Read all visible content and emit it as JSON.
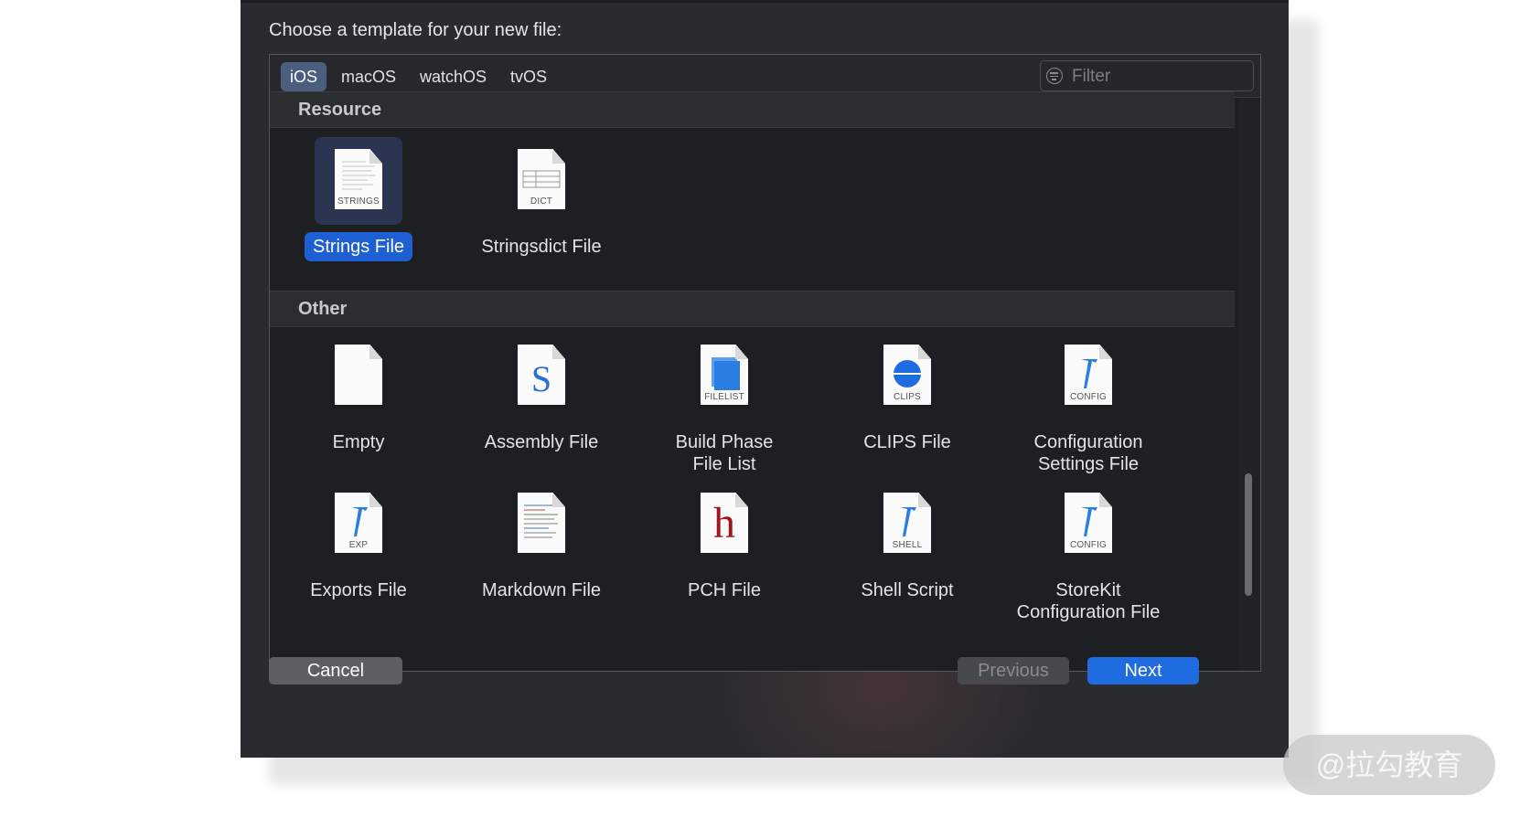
{
  "dialog": {
    "title": "Choose a template for your new file:"
  },
  "tabs": [
    {
      "label": "iOS",
      "active": true
    },
    {
      "label": "macOS"
    },
    {
      "label": "watchOS"
    },
    {
      "label": "tvOS"
    }
  ],
  "filter": {
    "placeholder": "Filter",
    "value": ""
  },
  "sections": [
    {
      "title": "Resource",
      "items": [
        {
          "label": "Strings File",
          "badge": "STRINGS",
          "icon": "strings-file-icon",
          "selected": true
        },
        {
          "label": "Stringsdict File",
          "badge": "DICT",
          "icon": "stringsdict-file-icon"
        }
      ]
    },
    {
      "title": "Other",
      "items": [
        {
          "label": "Empty",
          "badge": "",
          "icon": "empty-file-icon"
        },
        {
          "label": "Assembly File",
          "badge": "",
          "glyph": "S",
          "icon": "assembly-file-icon"
        },
        {
          "label": "Build Phase File List",
          "badge": "FILELIST",
          "icon": "filelist-icon"
        },
        {
          "label": "CLIPS File",
          "badge": "CLIPS",
          "icon": "clips-file-icon"
        },
        {
          "label": "Configuration Settings File",
          "badge": "CONFIG",
          "icon": "config-file-icon"
        },
        {
          "label": "Exports File",
          "badge": "EXP",
          "icon": "exports-file-icon"
        },
        {
          "label": "Markdown File",
          "badge": "",
          "icon": "markdown-file-icon"
        },
        {
          "label": "PCH File",
          "badge": "",
          "glyph": "h",
          "icon": "pch-file-icon"
        },
        {
          "label": "Shell Script",
          "badge": "SHELL",
          "icon": "shell-script-icon"
        },
        {
          "label": "StoreKit Configuration File",
          "badge": "CONFIG",
          "icon": "storekit-config-icon"
        }
      ]
    }
  ],
  "buttons": {
    "cancel": "Cancel",
    "previous": "Previous",
    "next": "Next"
  },
  "watermark": "@拉勾教育",
  "colors": {
    "accent": "#1f6ce0",
    "selected_tab": "#4b5e7d",
    "dialog_bg": "#2a2b2f",
    "icon_blue": "#2a7de1",
    "pch_red": "#a1151d"
  }
}
